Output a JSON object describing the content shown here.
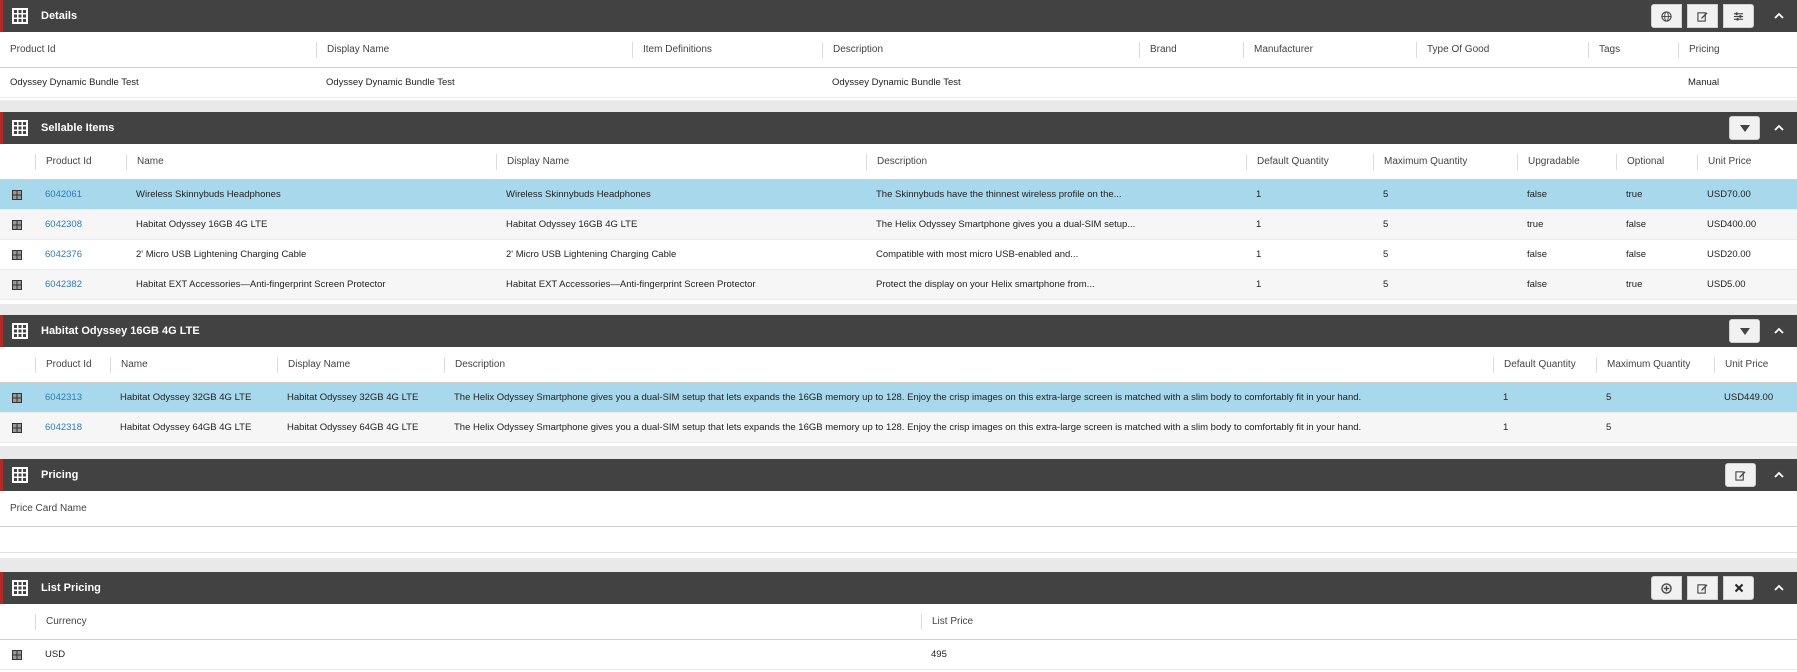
{
  "details": {
    "title": "Details",
    "headers": [
      "Product Id",
      "Display Name",
      "Item Definitions",
      "Description",
      "Brand",
      "Manufacturer",
      "Type Of Good",
      "Tags",
      "Pricing"
    ],
    "row": [
      "Odyssey Dynamic Bundle Test",
      "Odyssey Dynamic Bundle Test",
      "",
      "Odyssey Dynamic Bundle Test",
      "",
      "",
      "",
      "",
      "Manual"
    ]
  },
  "sellable": {
    "title": "Sellable Items",
    "headers": [
      "Product Id",
      "Name",
      "Display Name",
      "Description",
      "Default Quantity",
      "Maximum Quantity",
      "Upgradable",
      "Optional",
      "Unit Price"
    ],
    "rows": [
      [
        "6042061",
        "Wireless Skinnybuds Headphones",
        "Wireless Skinnybuds Headphones",
        "The Skinnybuds have the thinnest wireless profile on the...",
        "1",
        "5",
        "false",
        "true",
        "USD70.00"
      ],
      [
        "6042308",
        "Habitat Odyssey 16GB 4G LTE",
        "Habitat Odyssey 16GB 4G LTE",
        "The Helix Odyssey Smartphone gives you a dual-SIM setup...",
        "1",
        "5",
        "true",
        "false",
        "USD400.00"
      ],
      [
        "6042376",
        "2' Micro USB Lightening Charging Cable",
        "2' Micro USB Lightening Charging Cable",
        "Compatible with most micro USB-enabled and...",
        "1",
        "5",
        "false",
        "false",
        "USD20.00"
      ],
      [
        "6042382",
        "Habitat EXT Accessories—Anti-fingerprint Screen Protector",
        "Habitat EXT Accessories—Anti-fingerprint Screen Protector",
        "Protect the display on your Helix smartphone from...",
        "1",
        "5",
        "false",
        "true",
        "USD5.00"
      ]
    ]
  },
  "habitat": {
    "title": "Habitat Odyssey 16GB 4G LTE",
    "headers": [
      "Product Id",
      "Name",
      "Display Name",
      "Description",
      "Default Quantity",
      "Maximum Quantity",
      "Unit Price"
    ],
    "rows": [
      [
        "6042313",
        "Habitat Odyssey 32GB 4G LTE",
        "Habitat Odyssey 32GB 4G LTE",
        "The Helix Odyssey Smartphone gives you a dual-SIM setup that lets expands the 16GB memory up to 128. Enjoy the crisp images on this extra-large screen is matched with a slim body to comfortably fit in your hand.",
        "1",
        "5",
        "USD449.00"
      ],
      [
        "6042318",
        "Habitat Odyssey 64GB 4G LTE",
        "Habitat Odyssey 64GB 4G LTE",
        "The Helix Odyssey Smartphone gives you a dual-SIM setup that lets expands the 16GB memory up to 128. Enjoy the crisp images on this extra-large screen is matched with a slim body to comfortably fit in your hand.",
        "1",
        "5",
        ""
      ]
    ]
  },
  "pricing": {
    "title": "Pricing",
    "headers": [
      "Price Card Name"
    ]
  },
  "list_pricing": {
    "title": "List Pricing",
    "headers": [
      "Currency",
      "List Price"
    ],
    "rows": [
      [
        "USD",
        "495"
      ]
    ]
  },
  "icons": {
    "section": "grid-icon",
    "row": "row-grid-icon",
    "globe": "globe-icon",
    "edit": "edit-icon",
    "filter": "sliders-icon",
    "dropdown": "caret-down-icon",
    "collapse": "chevron-up-icon",
    "add": "plus-circle-icon",
    "close": "close-icon"
  },
  "colors": {
    "header_bar": "#424242",
    "accent": "#b02a2a",
    "selected_row": "#a8d8ec",
    "link": "#2b7cb7"
  }
}
